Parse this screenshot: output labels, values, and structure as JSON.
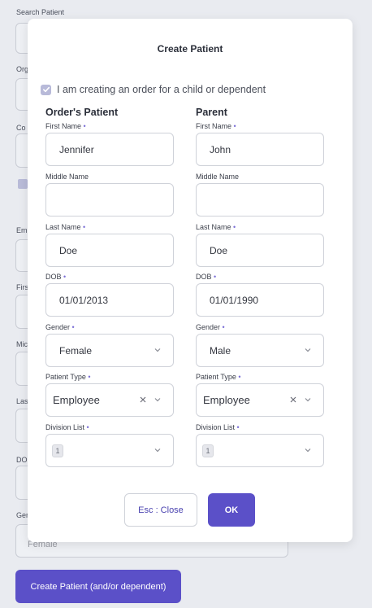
{
  "background": {
    "search_label": "Search Patient",
    "labels_partial": [
      "Org",
      "Co",
      "Em",
      "Firs",
      "Mic",
      "Las",
      "DO",
      "Gen"
    ],
    "gender_value_partial": "Female",
    "create_button": "Create Patient (and/or dependent)"
  },
  "modal": {
    "title": "Create Patient",
    "dependent_label": "I am creating an order for a child or dependent",
    "dependent_checked": true,
    "labels": {
      "first_name": "First Name",
      "middle_name": "Middle Name",
      "last_name": "Last Name",
      "dob": "DOB",
      "gender": "Gender",
      "patient_type": "Patient Type",
      "division_list": "Division List"
    },
    "required_marker": "•",
    "patient": {
      "heading": "Order's Patient",
      "first_name": "Jennifer",
      "middle_name": "",
      "last_name": "Doe",
      "dob": "01/01/2013",
      "gender": "Female",
      "patient_type": "Employee",
      "division": "1"
    },
    "parent": {
      "heading": "Parent",
      "first_name": "John",
      "middle_name": "",
      "last_name": "Doe",
      "dob": "01/01/1990",
      "gender": "Male",
      "patient_type": "Employee",
      "division": "1"
    },
    "close_button": "Esc : Close",
    "ok_button": "OK"
  },
  "colors": {
    "accent": "#5b50c8",
    "checkbox": "#b8bad9"
  }
}
